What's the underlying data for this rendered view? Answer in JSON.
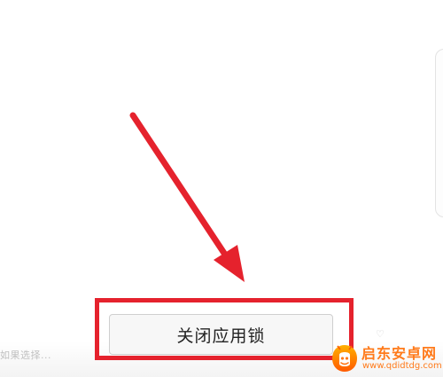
{
  "action_button": {
    "label": "关闭应用锁"
  },
  "footer": {
    "faint_text": "如果选择..."
  },
  "watermark": {
    "name": "启东安卓网",
    "url": "www.qdidtdg.com"
  },
  "icons": {
    "arrow": "arrow-pointer-icon",
    "logo": "android-logo-icon",
    "heart": "heart-icon"
  },
  "colors": {
    "highlight": "#e5222d",
    "watermark": "#ff7a1a",
    "button_bg": "#f7f7f7"
  }
}
